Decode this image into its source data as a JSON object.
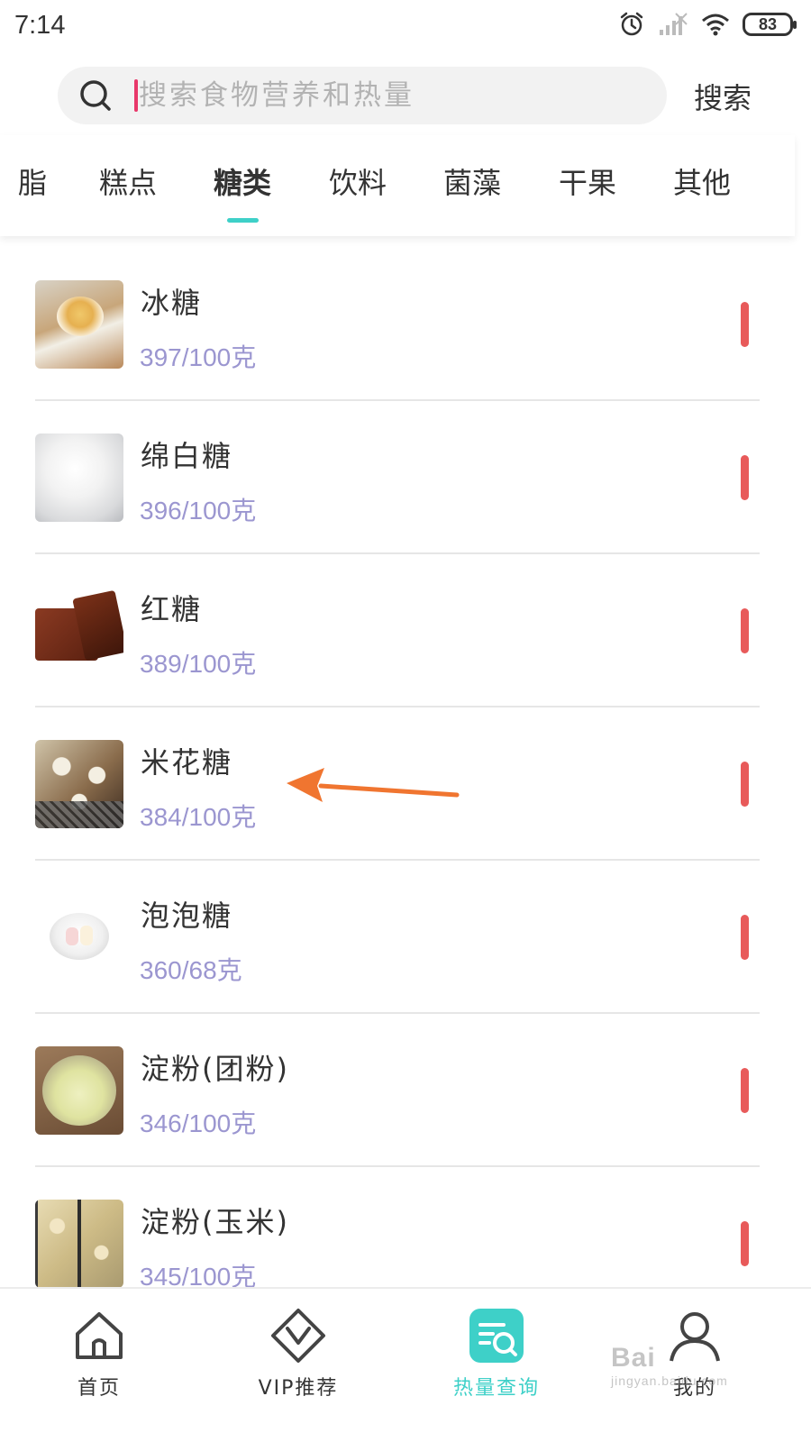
{
  "status_bar": {
    "time": "7:14",
    "battery": "83"
  },
  "search": {
    "placeholder": "搜索食物营养和热量",
    "button_label": "搜索"
  },
  "tabs": [
    {
      "label": "脂",
      "active": false
    },
    {
      "label": "糕点",
      "active": false
    },
    {
      "label": "糖类",
      "active": true
    },
    {
      "label": "饮料",
      "active": false
    },
    {
      "label": "菌藻",
      "active": false
    },
    {
      "label": "干果",
      "active": false
    },
    {
      "label": "其他",
      "active": false
    }
  ],
  "foods": [
    {
      "name": "冰糖",
      "calories": "397/100克"
    },
    {
      "name": "绵白糖",
      "calories": "396/100克"
    },
    {
      "name": "红糖",
      "calories": "389/100克"
    },
    {
      "name": "米花糖",
      "calories": "384/100克"
    },
    {
      "name": "泡泡糖",
      "calories": "360/68克"
    },
    {
      "name": "淀粉(团粉)",
      "calories": "346/100克"
    },
    {
      "name": "淀粉(玉米)",
      "calories": "345/100克"
    }
  ],
  "bottom_nav": [
    {
      "label": "首页",
      "icon": "home-icon"
    },
    {
      "label": "VIP推荐",
      "icon": "vip-icon"
    },
    {
      "label": "热量查询",
      "icon": "calorie-search-icon",
      "active": true
    },
    {
      "label": "我的",
      "icon": "profile-icon"
    }
  ],
  "watermark": {
    "main": "Bai",
    "sub": "jingyan.baidu.com"
  },
  "colors": {
    "accent": "#3ed0c8",
    "calorie_text": "#9b96d0",
    "level_bar": "#e85a5a",
    "caret": "#e8386a",
    "annotation_arrow": "#f07530"
  }
}
